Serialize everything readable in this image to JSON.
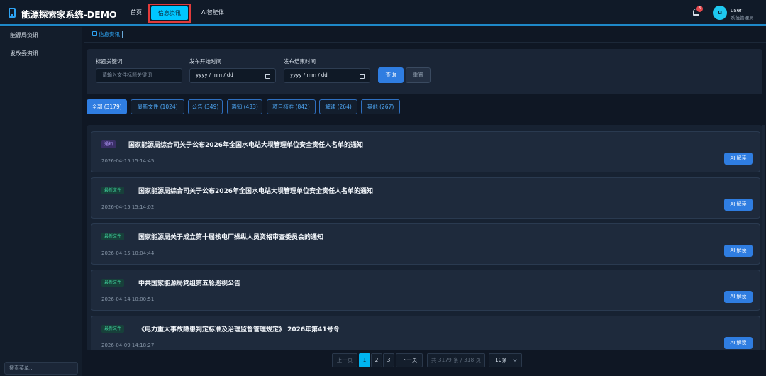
{
  "header": {
    "app_title": "能源探索家系统-DEMO",
    "nav": [
      {
        "label": "首页"
      },
      {
        "label": "信息资讯"
      },
      {
        "label": "AI智能体"
      }
    ],
    "notification_count": "3",
    "user": {
      "avatar_letter": "u",
      "name": "user",
      "role": "系统管理员"
    }
  },
  "sidebar": {
    "items": [
      {
        "label": "能源局资讯"
      },
      {
        "label": "发改委资讯"
      }
    ],
    "search_placeholder": "搜索菜单..."
  },
  "breadcrumb": {
    "current": "信息资讯"
  },
  "filter": {
    "keyword_label": "标题关键词",
    "keyword_placeholder": "请输入文件标题关键词",
    "start_label": "发布开始时间",
    "start_placeholder": "yyyy / mm / dd",
    "end_label": "发布结束时间",
    "end_placeholder": "yyyy / mm / dd",
    "query_label": "查询",
    "reset_label": "重置"
  },
  "categories": [
    {
      "label": "全部 (3179)"
    },
    {
      "label": "最新文件 (1024)"
    },
    {
      "label": "公告 (349)"
    },
    {
      "label": "通知 (433)"
    },
    {
      "label": "项目核准 (842)"
    },
    {
      "label": "解读 (264)"
    },
    {
      "label": "其他 (267)"
    }
  ],
  "news": [
    {
      "tag": "通知",
      "title": "国家能源局综合司关于公布2026年全国水电站大坝管理单位安全责任人名单的通知",
      "date": "2026-04-15 15:14:45",
      "action": "AI 解读"
    },
    {
      "tag": "最新文件",
      "title": "国家能源局综合司关于公布2026年全国水电站大坝管理单位安全责任人名单的通知",
      "date": "2026-04-15 15:14:02",
      "action": "AI 解读"
    },
    {
      "tag": "最新文件",
      "title": "国家能源局关于成立第十届核电厂操纵人员资格审查委员会的通知",
      "date": "2026-04-15 10:04:44",
      "action": "AI 解读"
    },
    {
      "tag": "最新文件",
      "title": "中共国家能源局党组第五轮巡视公告",
      "date": "2026-04-14 10:00:51",
      "action": "AI 解读"
    },
    {
      "tag": "最新文件",
      "title": "《电力重大事故隐患判定标准及治理监督管理规定》 2026年第41号令",
      "date": "2026-04-09 14:18:27",
      "action": "AI 解读"
    }
  ],
  "pagination": {
    "prev": "上一页",
    "pages": [
      "1",
      "2",
      "3"
    ],
    "next": "下一页",
    "summary": "共 3179 条 / 318 页",
    "page_size": "10条"
  }
}
